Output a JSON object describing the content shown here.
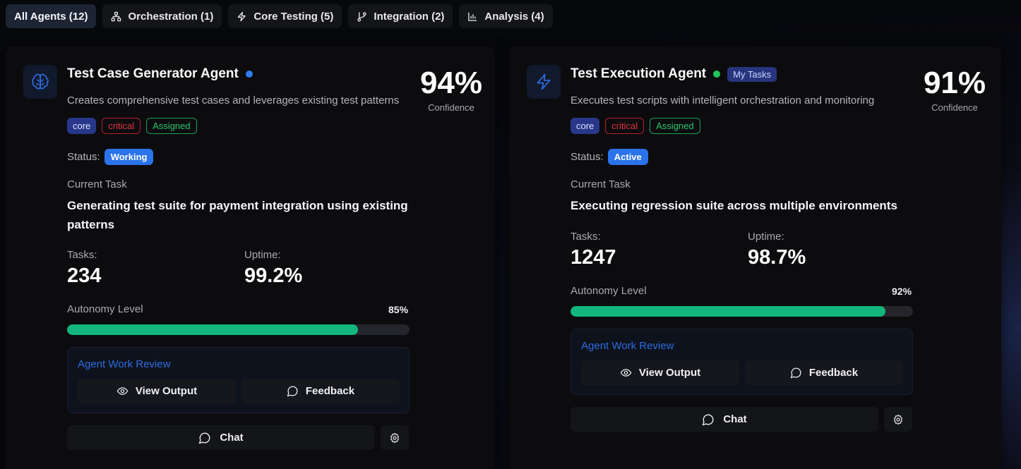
{
  "filter_tabs": [
    {
      "label": "All Agents (12)",
      "icon": "grid-icon",
      "active": true
    },
    {
      "label": "Orchestration (1)",
      "icon": "network-icon",
      "active": false
    },
    {
      "label": "Core Testing (5)",
      "icon": "bolt-icon",
      "active": false
    },
    {
      "label": "Integration (2)",
      "icon": "git-branch-icon",
      "active": false
    },
    {
      "label": "Analysis (4)",
      "icon": "bar-chart-icon",
      "active": false
    }
  ],
  "agents": [
    {
      "name": "Test Case Generator Agent",
      "icon": "brain-icon",
      "status_dot_color": "#2f7bf0",
      "description": "Creates comprehensive test cases and leverages existing test patterns",
      "tags": [
        "core",
        "critical",
        "Assigned"
      ],
      "confidence": "94%",
      "confidence_label": "Confidence",
      "status_label": "Status:",
      "status": "Working",
      "current_task_label": "Current Task",
      "current_task": "Generating test suite for payment integration using existing patterns",
      "tasks_label": "Tasks:",
      "tasks": "234",
      "uptime_label": "Uptime:",
      "uptime": "99.2%",
      "autonomy_label": "Autonomy Level",
      "autonomy_text": "85%",
      "autonomy": 85,
      "review_title": "Agent Work Review",
      "view_output": "View Output",
      "feedback": "Feedback",
      "chat": "Chat"
    },
    {
      "name": "Test Execution Agent",
      "icon": "bolt-icon",
      "status_dot_color": "#22c55e",
      "my_tasks": "My Tasks",
      "description": "Executes test scripts with intelligent orchestration and monitoring",
      "tags": [
        "core",
        "critical",
        "Assigned"
      ],
      "confidence": "91%",
      "confidence_label": "Confidence",
      "status_label": "Status:",
      "status": "Active",
      "current_task_label": "Current Task",
      "current_task": "Executing regression suite across multiple environments",
      "tasks_label": "Tasks:",
      "tasks": "1247",
      "uptime_label": "Uptime:",
      "uptime": "98.7%",
      "autonomy_label": "Autonomy Level",
      "autonomy_text": "92%",
      "autonomy": 92,
      "review_title": "Agent Work Review",
      "view_output": "View Output",
      "feedback": "Feedback",
      "chat": "Chat"
    }
  ],
  "colors": {
    "accent_blue": "#2f6be0",
    "progress_green": "#13b77d",
    "critical_red": "#e0353e",
    "assigned_green": "#2ec46c"
  }
}
